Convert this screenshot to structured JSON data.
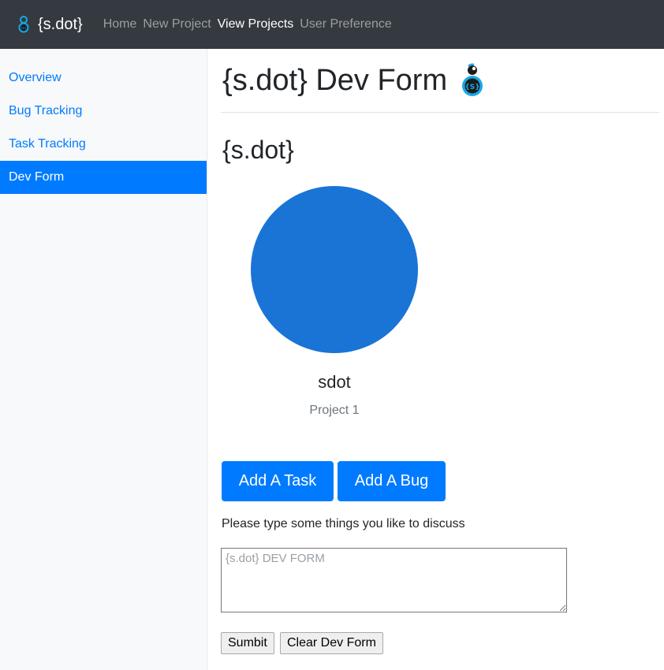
{
  "colors": {
    "navbar_bg": "#343a40",
    "primary": "#007bff",
    "avatar": "#1a74d6",
    "sidebar_bg": "#f8f9fa",
    "logo_accent": "#1aa7e6"
  },
  "navbar": {
    "brand": "{s.dot}",
    "logo_icon": "sdot-mascot-icon",
    "links": [
      {
        "label": "Home",
        "active": false
      },
      {
        "label": "New Project",
        "active": false
      },
      {
        "label": "View Projects",
        "active": true
      },
      {
        "label": "User Preference",
        "active": false
      }
    ]
  },
  "sidebar": {
    "items": [
      {
        "label": "Overview",
        "active": false
      },
      {
        "label": "Bug Tracking",
        "active": false
      },
      {
        "label": "Task Tracking",
        "active": false
      },
      {
        "label": "Dev Form",
        "active": true
      }
    ]
  },
  "main": {
    "title": "{s.dot} Dev Form",
    "title_icon": "sdot-mascot-icon",
    "subtitle": "{s.dot}",
    "card": {
      "name": "sdot",
      "project": "Project 1"
    },
    "buttons": {
      "add_task": "Add A Task",
      "add_bug": "Add A Bug"
    },
    "prompt": "Please type some things you like to discuss",
    "textarea": {
      "placeholder": "{s.dot} DEV FORM",
      "value": ""
    },
    "form_buttons": {
      "submit": "Sumbit",
      "clear": "Clear Dev Form"
    }
  }
}
